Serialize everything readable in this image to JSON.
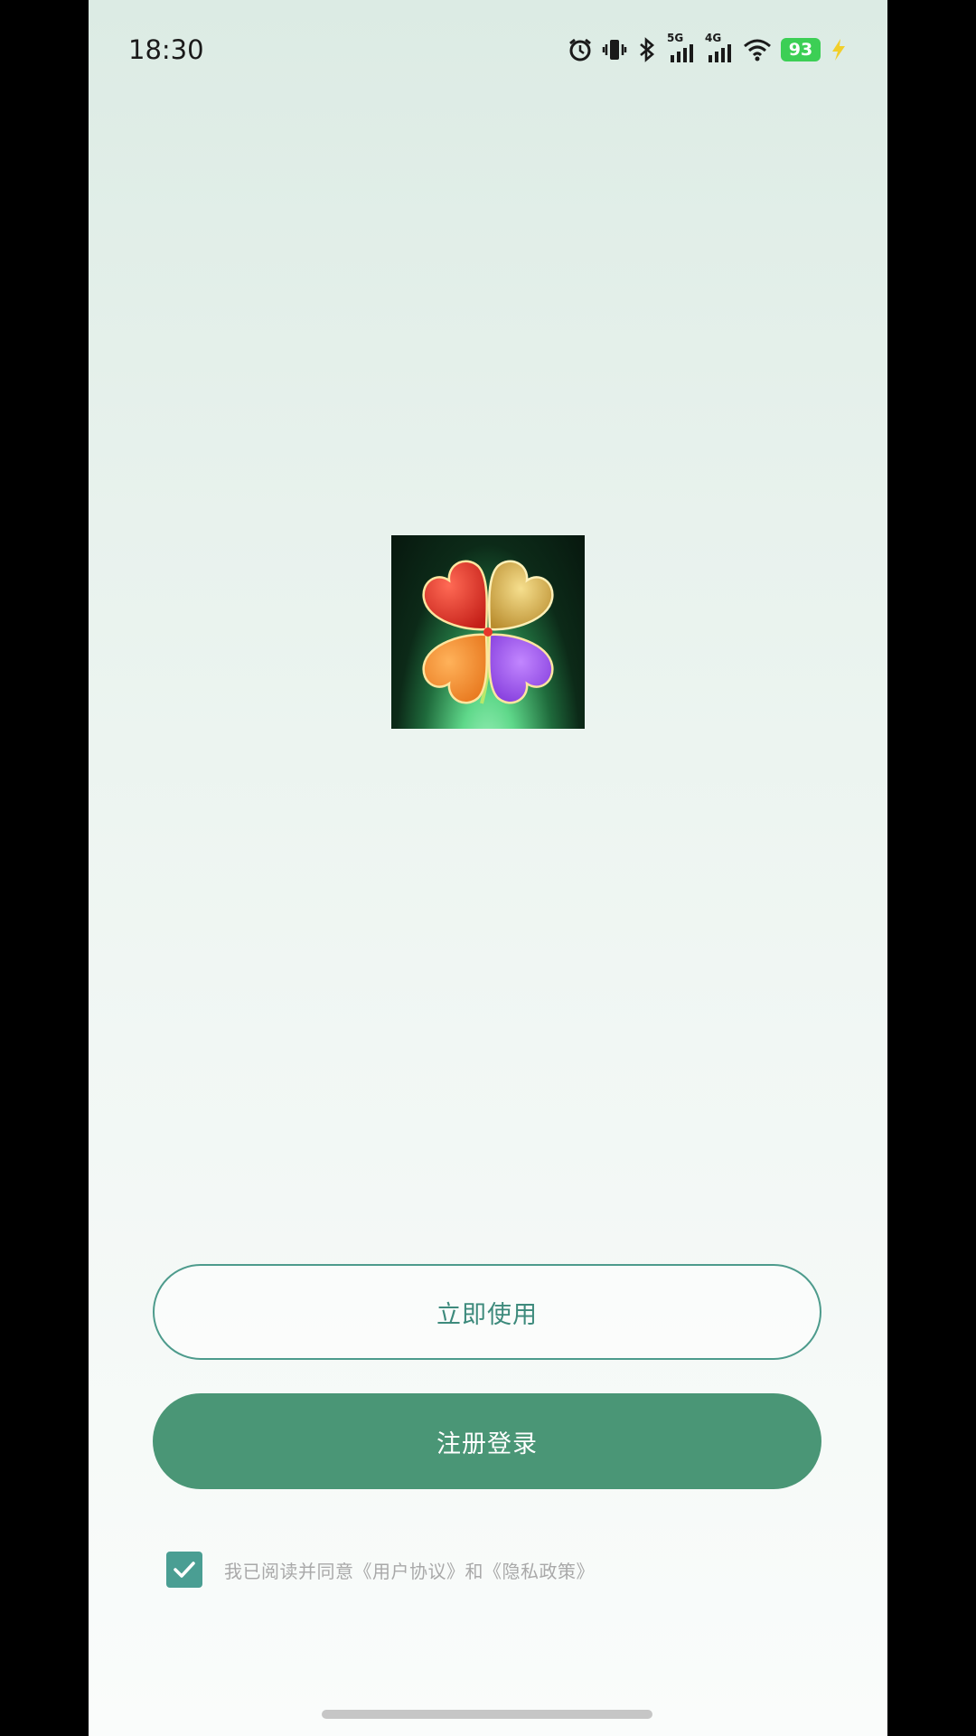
{
  "status_bar": {
    "time": "18:30",
    "network_5g": "5G",
    "network_4g": "4G",
    "battery": "93",
    "icons": [
      "alarm-icon",
      "vibrate-icon",
      "bluetooth-icon",
      "signal-5g-icon",
      "signal-4g-icon",
      "wifi-icon",
      "battery-icon",
      "charging-icon"
    ]
  },
  "logo": {
    "icon": "four-leaf-clover-icon",
    "colors": {
      "top_left": "#e23a2e",
      "top_right": "#d9b44a",
      "bottom_left": "#f08a2c",
      "bottom_right": "#9a4ee6"
    }
  },
  "buttons": {
    "use_now": "立即使用",
    "register_login": "注册登录"
  },
  "agreement": {
    "checked": true,
    "text": "我已阅读并同意《用户协议》和《隐私政策》"
  },
  "colors": {
    "primary": "#4a9676",
    "outline": "#4d9b8c",
    "checkbox": "#4a9e93"
  }
}
